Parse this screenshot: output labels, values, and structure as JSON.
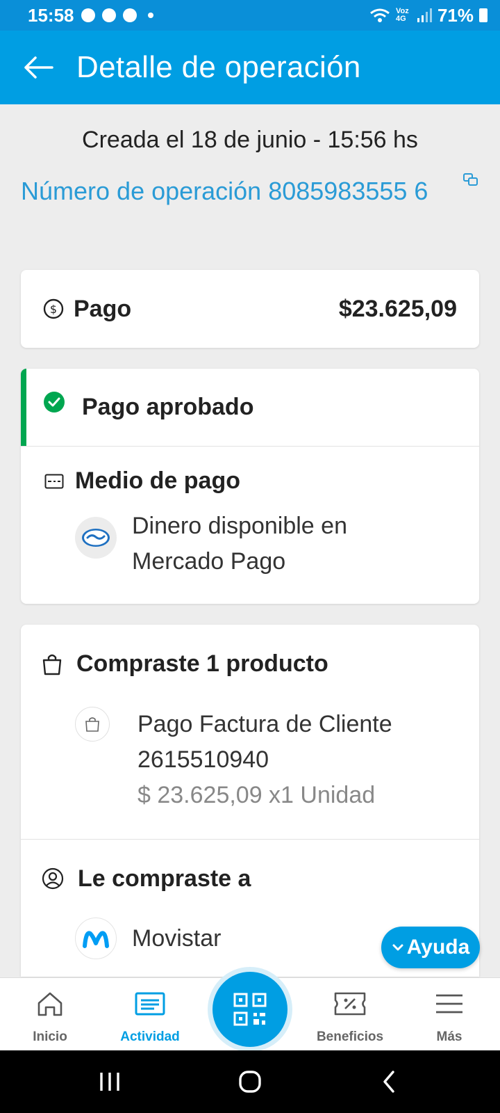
{
  "status_bar": {
    "time": "15:58",
    "battery": "71%",
    "network": "Voz 4G",
    "icons": [
      "chat-icon",
      "chrome-icon",
      "messenger-icon",
      "wifi-icon",
      "signal-icon",
      "battery-icon"
    ]
  },
  "app_bar": {
    "title": "Detalle de operación",
    "back_icon": "arrow-left-icon"
  },
  "operation": {
    "created": "Creada el 18 de junio - 15:56 hs",
    "number_label": "Número de operación 8085983555 6"
  },
  "payment": {
    "label": "Pago",
    "amount": "$23.625,09"
  },
  "status": {
    "approved_label": "Pago aprobado",
    "accent_color": "#00a650"
  },
  "payment_method": {
    "title": "Medio de pago",
    "description": "Dinero disponible en Mercado Pago"
  },
  "purchase": {
    "title": "Compraste 1 producto",
    "product_name": "Pago Factura de Cliente 2615510940",
    "product_price": "$ 23.625,09 x1 Unidad"
  },
  "seller": {
    "title": "Le compraste a",
    "name": "Movistar"
  },
  "help": {
    "label": "Ayuda"
  },
  "bottom_nav": {
    "items": [
      {
        "label": "Inicio",
        "icon": "home-icon",
        "active": false
      },
      {
        "label": "Actividad",
        "icon": "activity-icon",
        "active": true
      },
      {
        "label": "",
        "icon": "qr-icon",
        "active": false
      },
      {
        "label": "Beneficios",
        "icon": "coupon-icon",
        "active": false
      },
      {
        "label": "Más",
        "icon": "menu-icon",
        "active": false
      }
    ]
  },
  "colors": {
    "primary": "#009ee3",
    "status_bar": "#0a8fd8",
    "link": "#2a9bd6",
    "success": "#00a650"
  }
}
